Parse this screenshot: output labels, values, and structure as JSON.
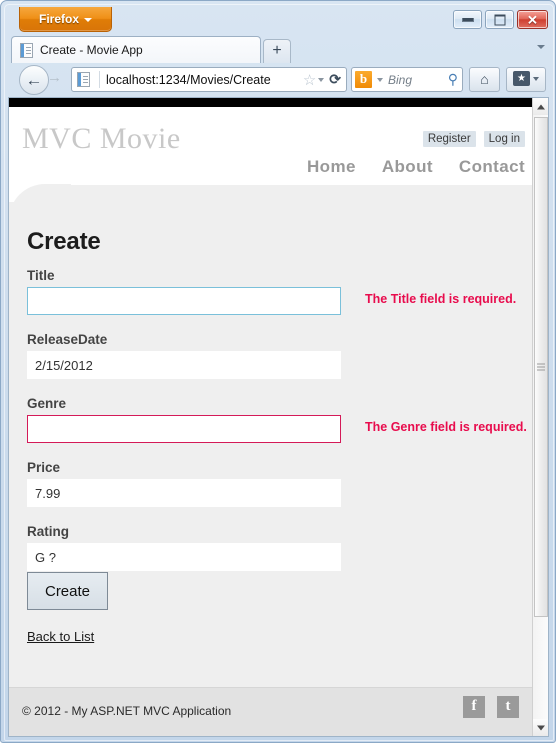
{
  "browser": {
    "app_button": "Firefox",
    "window_controls": {
      "minimize": "minimize-button",
      "maximize": "maximize-button",
      "close": "✕"
    },
    "tab": {
      "title": "Create - Movie App",
      "new_tab_label": "+"
    },
    "url": "localhost:1234/Movies/Create",
    "search": {
      "engine": "Bing",
      "engine_initial": "b",
      "placeholder": "Bing"
    },
    "icons": {
      "back": "←",
      "forward": "→",
      "star": "☆",
      "reload": "⟳",
      "magnifier": "⚲",
      "home": "⌂"
    }
  },
  "site": {
    "brand": "MVC Movie",
    "auth_links": [
      {
        "label": "Register"
      },
      {
        "label": "Log in"
      }
    ],
    "nav_links": [
      {
        "label": "Home"
      },
      {
        "label": "About"
      },
      {
        "label": "Contact"
      }
    ]
  },
  "page": {
    "heading": "Create",
    "fields": [
      {
        "label": "Title",
        "value": "",
        "state": "focused",
        "validation": "The Title field is required."
      },
      {
        "label": "ReleaseDate",
        "value": "2/15/2012",
        "state": "normal",
        "validation": ""
      },
      {
        "label": "Genre",
        "value": "",
        "state": "error",
        "validation": "The Genre field is required."
      },
      {
        "label": "Price",
        "value": "7.99",
        "state": "normal",
        "validation": ""
      },
      {
        "label": "Rating",
        "value": "G ?",
        "state": "normal",
        "validation": ""
      }
    ],
    "submit_label": "Create",
    "back_link": "Back to List"
  },
  "footer": {
    "copyright": "© 2012 - My ASP.NET MVC Application",
    "social": [
      {
        "name": "facebook-icon",
        "glyph": "f"
      },
      {
        "name": "twitter-icon",
        "glyph": "t"
      }
    ]
  },
  "colors": {
    "accent_error": "#e80c4d",
    "focus_border": "#7ac0da",
    "error_border": "#d41a58",
    "firefox_orange": "#ef8f16",
    "page_background": "#efefef"
  }
}
